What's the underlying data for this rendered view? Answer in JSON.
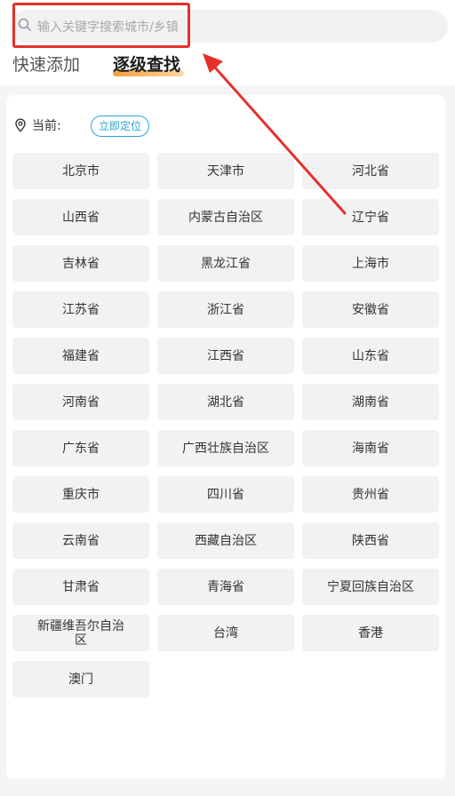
{
  "search": {
    "placeholder": "输入关键字搜索城市/乡镇"
  },
  "tabs": [
    {
      "label": "快速添加"
    },
    {
      "label": "逐级查找"
    }
  ],
  "current": {
    "label": "当前:",
    "locate_label": "立即定位"
  },
  "provinces": [
    "北京市",
    "天津市",
    "河北省",
    "山西省",
    "内蒙古自治区",
    "辽宁省",
    "吉林省",
    "黑龙江省",
    "上海市",
    "江苏省",
    "浙江省",
    "安徽省",
    "福建省",
    "江西省",
    "山东省",
    "河南省",
    "湖北省",
    "湖南省",
    "广东省",
    "广西壮族自治区",
    "海南省",
    "重庆市",
    "四川省",
    "贵州省",
    "云南省",
    "西藏自治区",
    "陕西省",
    "甘肃省",
    "青海省",
    "宁夏回族自治区",
    "新疆维吾尔自治区",
    "台湾",
    "香港",
    "澳门"
  ],
  "colors": {
    "highlight": "#e5312b",
    "accent_blue": "#2aa3d6",
    "tab_underline": "#f2a03d"
  }
}
